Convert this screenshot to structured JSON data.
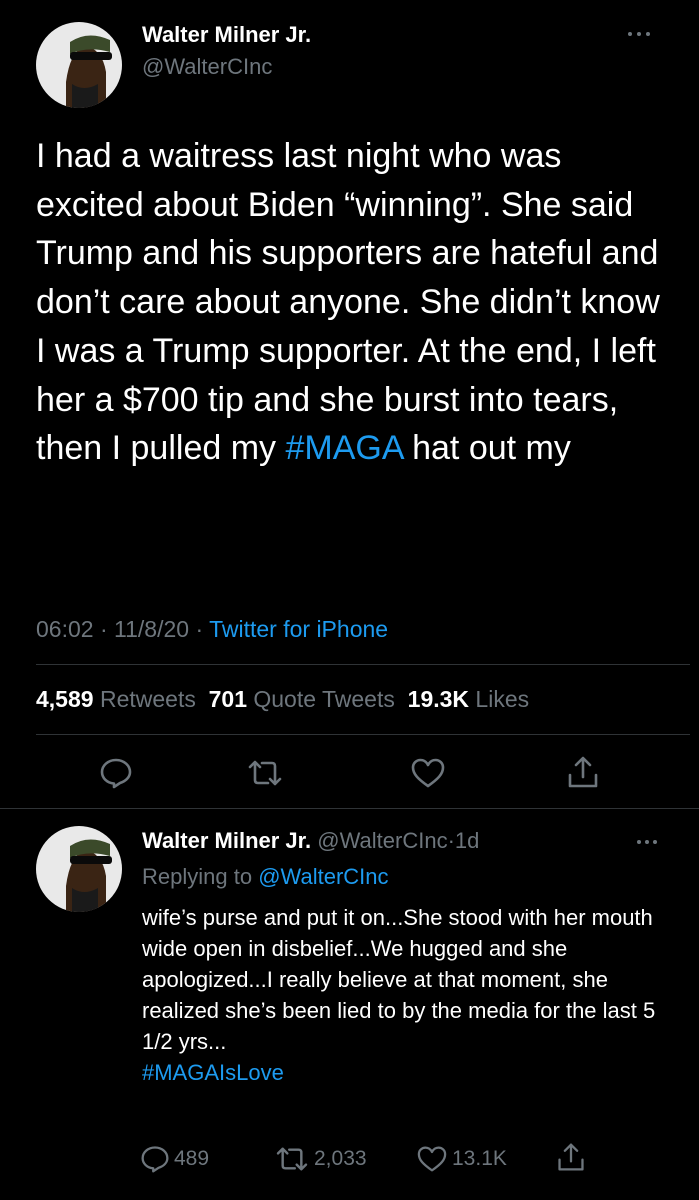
{
  "main_tweet": {
    "author_name": "Walter Milner Jr.",
    "handle": "@WalterCInc",
    "text_before": "I had a waitress last night who was excited about Biden “winning”.  She said Trump and his supporters are hateful and don’t care about anyone. She didn’t know I was a Trump supporter.  At the end, I left her a $700 tip and she burst into tears, then I pulled my ",
    "hashtag": "#MAGA",
    "text_after": " hat out my",
    "time": "06:02",
    "date": "11/8/20",
    "separator": "·",
    "source": "Twitter for iPhone",
    "stats": {
      "retweets_count": "4,589",
      "retweets_label": "Retweets",
      "quotes_count": "701",
      "quotes_label": "Quote Tweets",
      "likes_count": "19.3K",
      "likes_label": "Likes"
    },
    "actions": [
      "reply-icon",
      "retweet-icon",
      "like-icon",
      "share-icon"
    ]
  },
  "reply_tweet": {
    "author_name": "Walter Milner Jr.",
    "handle": "@WalterCInc",
    "age": "1d",
    "separator": "·",
    "replying_label": "Replying to",
    "replying_to": "@WalterCInc",
    "text": "wife’s purse and put it on...She stood with her mouth wide open in disbelief...We hugged and she apologized...I really believe at that moment, she realized she’s been lied to by the media for the last 5 1/2 yrs...",
    "hashtag": "#MAGAIsLove",
    "replies": "489",
    "retweets": "2,033",
    "likes": "13.1K"
  },
  "colors": {
    "background": "#000000",
    "text": "#ffffff",
    "secondary": "#6e767d",
    "accent": "#1d9bf0",
    "divider": "#2f3336"
  }
}
